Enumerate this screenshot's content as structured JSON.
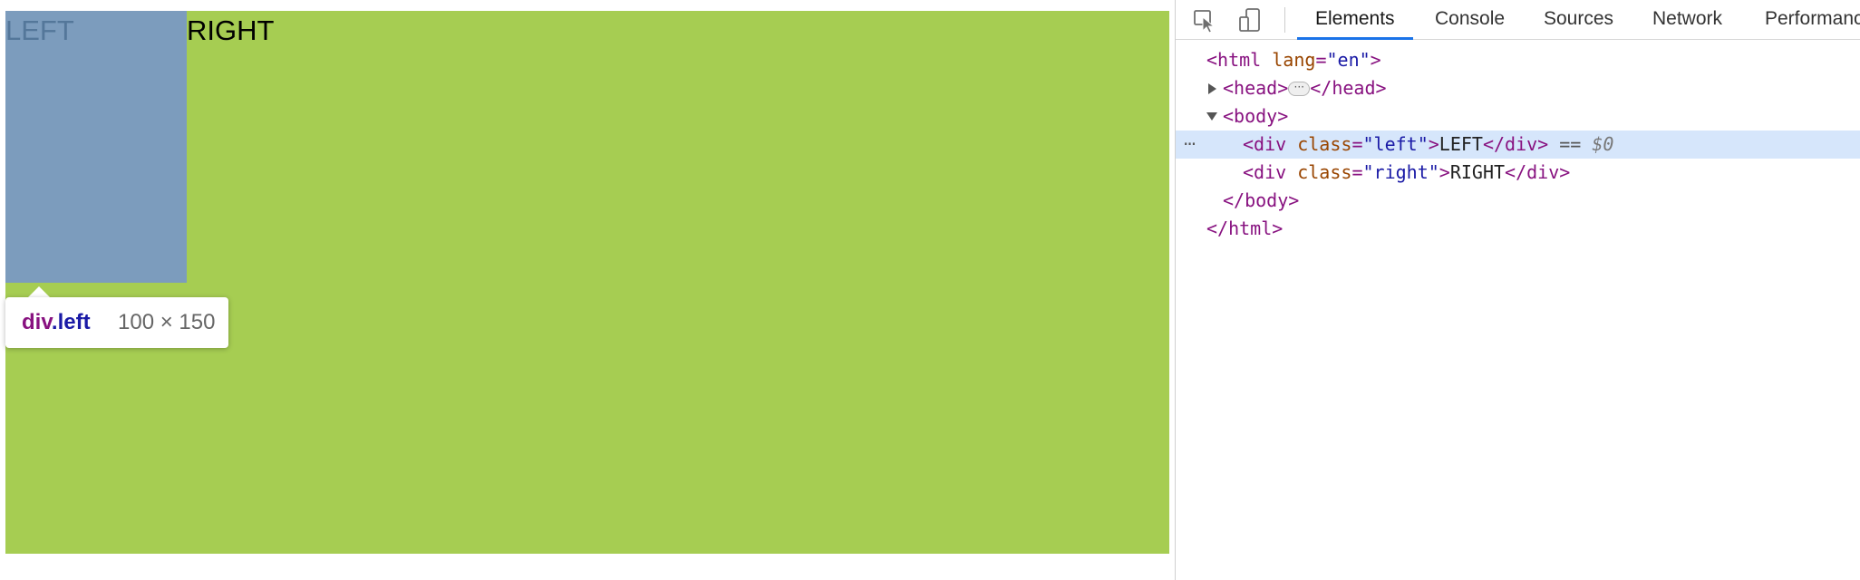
{
  "viewport": {
    "left_text": "LEFT",
    "right_text": "RIGHT",
    "colors": {
      "right_bg": "#a6cd52",
      "left_bg": "#7c9cbd"
    }
  },
  "tooltip": {
    "tag": "div",
    "class": ".left",
    "size": "100 × 150"
  },
  "devtools": {
    "toolbar": {
      "icons": [
        "inspect-element-icon",
        "device-toolbar-icon"
      ]
    },
    "tabs": [
      {
        "label": "Elements",
        "active": true
      },
      {
        "label": "Console"
      },
      {
        "label": "Sources"
      },
      {
        "label": "Network"
      },
      {
        "label": "Performance"
      }
    ],
    "accent": "#1a73e8",
    "dom": {
      "html_open_tag": "<html",
      "html_attr_name": "lang",
      "html_attr_value": "\"en\"",
      "close_angle": ">",
      "head_open": "<head>",
      "head_close": "</head>",
      "body_open": "<body>",
      "div_open": "<div",
      "class_attr": "class",
      "eq": "=",
      "left_class_value": "\"left\"",
      "left_text": "LEFT",
      "div_close": "</div>",
      "selected_marker": "== ",
      "selected_var": "$0",
      "right_class_value": "\"right\"",
      "right_text": "RIGHT",
      "body_close": "</body>",
      "html_close": "</html>",
      "gutter": "···"
    }
  }
}
